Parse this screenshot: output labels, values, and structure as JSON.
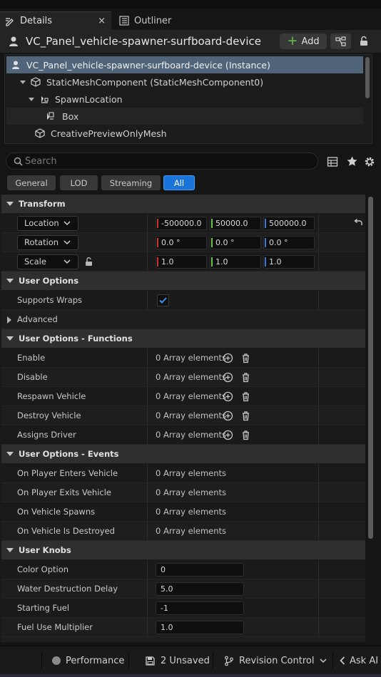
{
  "tabs": {
    "details_label": "Details",
    "outliner_label": "Outliner",
    "close_glyph": "×"
  },
  "actor": {
    "title": "VC_Panel_vehicle-spawner-surfboard-device",
    "add_label": "Add",
    "add_glyph": "+"
  },
  "tree": {
    "items": [
      {
        "label": "VC_Panel_vehicle-spawner-surfboard-device (Instance)",
        "icon": "actor-icon"
      },
      {
        "label": "StaticMeshComponent (StaticMeshComponent0)",
        "icon": "static-mesh-icon"
      },
      {
        "label": "SpawnLocation",
        "icon": "scene-component-icon"
      },
      {
        "label": "Box",
        "icon": "box-component-icon"
      },
      {
        "label": "CreativePreviewOnlyMesh",
        "icon": "static-mesh-icon"
      }
    ]
  },
  "search": {
    "placeholder": "Search"
  },
  "filters": {
    "general": "General",
    "lod": "LOD",
    "streaming": "Streaming",
    "all": "All",
    "active": "All"
  },
  "transform": {
    "title": "Transform",
    "location_label": "Location",
    "rotation_label": "Rotation",
    "scale_label": "Scale",
    "location": [
      "-500000.0",
      "50000.0",
      "500000.0"
    ],
    "rotation": [
      "0.0 °",
      "0.0 °",
      "0.0 °"
    ],
    "scale": [
      "1.0",
      "1.0",
      "1.0"
    ],
    "axis_colors": {
      "x": "#c83232",
      "y": "#6cc24a",
      "z": "#3a78d8"
    }
  },
  "user_options": {
    "title": "User Options",
    "supports_wraps_label": "Supports Wraps",
    "supports_wraps_checked": true,
    "advanced_label": "Advanced"
  },
  "functions": {
    "title": "User Options - Functions",
    "rows": [
      {
        "label": "Enable",
        "value": "0 Array elements"
      },
      {
        "label": "Disable",
        "value": "0 Array elements"
      },
      {
        "label": "Respawn Vehicle",
        "value": "0 Array elements"
      },
      {
        "label": "Destroy Vehicle",
        "value": "0 Array elements"
      },
      {
        "label": "Assigns Driver",
        "value": "0 Array elements"
      }
    ]
  },
  "events": {
    "title": "User Options - Events",
    "rows": [
      {
        "label": "On Player Enters Vehicle",
        "value": "0 Array elements"
      },
      {
        "label": "On Player Exits Vehicle",
        "value": "0 Array elements"
      },
      {
        "label": "On Vehicle Spawns",
        "value": "0 Array elements"
      },
      {
        "label": "On Vehicle Is Destroyed",
        "value": "0 Array elements"
      }
    ]
  },
  "knobs": {
    "title": "User Knobs",
    "rows": [
      {
        "label": "Color Option",
        "value": "0"
      },
      {
        "label": "Water Destruction Delay",
        "value": "5.0"
      },
      {
        "label": "Starting Fuel",
        "value": "-1"
      },
      {
        "label": "Fuel Use Multiplier",
        "value": "1.0"
      }
    ]
  },
  "statusbar": {
    "performance_label": "Performance",
    "unsaved_label": "2 Unsaved",
    "revision_label": "Revision Control",
    "ask_ai_label": "Ask AI"
  },
  "colors": {
    "accent": "#1a74d9",
    "selection": "#51657a",
    "add_plus": "#6cc24a"
  }
}
